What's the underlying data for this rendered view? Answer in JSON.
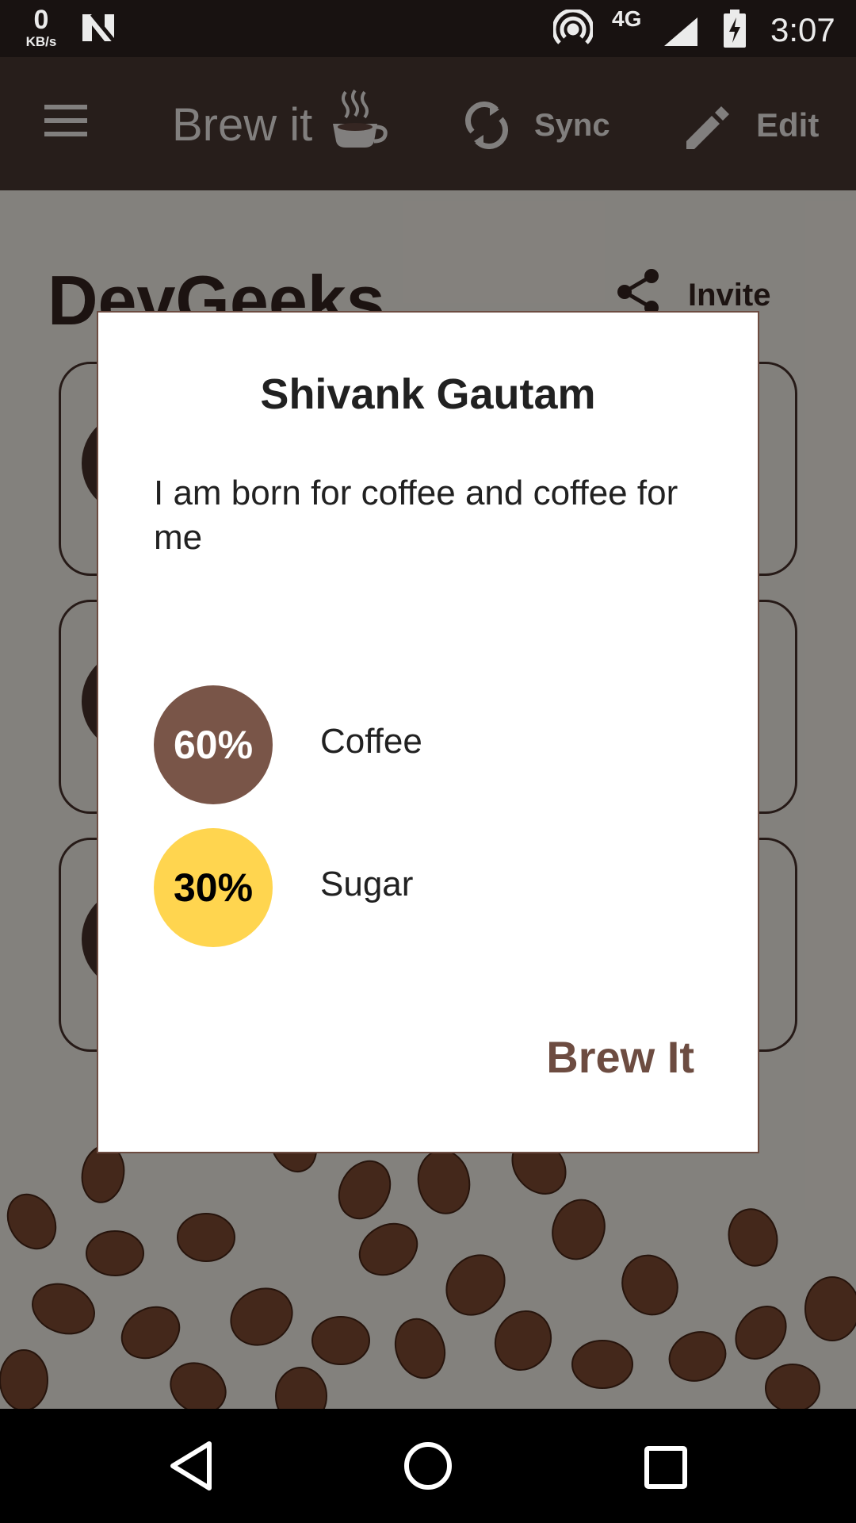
{
  "status_bar": {
    "speed_value": "0",
    "speed_unit": "KB/s",
    "network": "4G",
    "time": "3:07"
  },
  "app_bar": {
    "title": "Brew it",
    "sync_label": "Sync",
    "edit_label": "Edit",
    "icons": [
      "menu-icon",
      "coffee-cup-icon",
      "sync-icon",
      "edit-pencil-icon"
    ]
  },
  "background": {
    "team_name": "DevGeeks",
    "invite_label": "Invite"
  },
  "dialog": {
    "title": "Shivank Gautam",
    "bio": "I am born for coffee and coffee for me",
    "ingredients": [
      {
        "percent": "60%",
        "name": "Coffee",
        "percent_value": 60,
        "color": "#795548",
        "text_color": "#ffffff"
      },
      {
        "percent": "30%",
        "name": "Sugar",
        "percent_value": 30,
        "color": "#ffd54f",
        "text_color": "#000000"
      }
    ],
    "action_label": "Brew It"
  },
  "colors": {
    "app_bar": "#2b211e",
    "accent_brown": "#6d4c41",
    "status_bar": "#1b1413"
  }
}
